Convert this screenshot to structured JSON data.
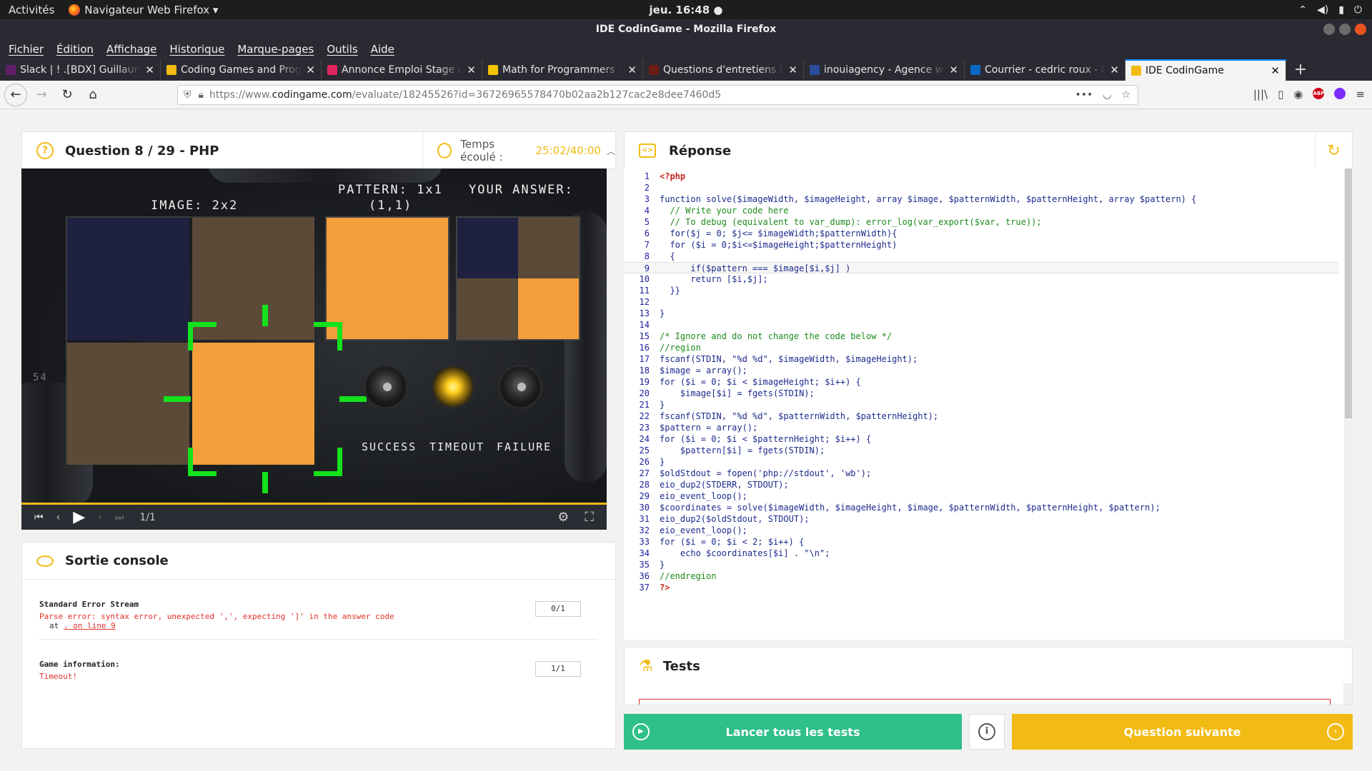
{
  "gnome": {
    "activities": "Activités",
    "app": "Navigateur Web Firefox ▾",
    "clock": "jeu. 16:48 ●",
    "tray": [
      "▾",
      "🔊",
      "🔋",
      "⏻"
    ]
  },
  "window": {
    "title": "IDE CodinGame - Mozilla Firefox"
  },
  "menu": [
    "Fichier",
    "Édition",
    "Affichage",
    "Historique",
    "Marque-pages",
    "Outils",
    "Aide"
  ],
  "tabs": [
    {
      "label": "Slack | ! .[BDX] Guillaume",
      "color": "#611f69"
    },
    {
      "label": "Coding Games and Progr",
      "color": "#f2bb13"
    },
    {
      "label": "Annonce Emploi Stage d",
      "color": "#e0245e"
    },
    {
      "label": "Math for Programmers -",
      "color": "#f5c400"
    },
    {
      "label": "Questions d'entretiens P",
      "color": "#6b1d12"
    },
    {
      "label": "inouiagency - Agence we",
      "color": "#2a4d9c"
    },
    {
      "label": "Courrier - cedric roux - O",
      "color": "#0a68c4"
    },
    {
      "label": "IDE CodinGame",
      "color": "#f2bb13"
    }
  ],
  "url": {
    "prefix": "https://www.",
    "domain": "codingame.com",
    "rest": "/evaluate/18245526?id=36726965578470b02aa2b127cac2e8dee7460d5"
  },
  "question": {
    "title": "Question 8 / 29 - PHP",
    "time_label": "Temps écoulé :",
    "time_value": "25:02/40:00"
  },
  "game": {
    "image_label": "IMAGE: 2x2",
    "pattern_label": "PATTERN: 1x1",
    "pattern_coords": "(1,1)",
    "answer_label": "YOUR ANSWER:",
    "status_success": "SUCCESS",
    "status_timeout": "TIMEOUT",
    "status_failure": "FAILURE",
    "frame": "1/1",
    "side_num": "54",
    "colors": {
      "navy": "#1e2140",
      "brown": "#5c4a39",
      "orange": "#f39f3c",
      "green": "#14e21c"
    }
  },
  "console": {
    "title": "Sortie console",
    "stderr_title": "Standard Error Stream",
    "stderr_msg": "Parse error: syntax error, unexpected ',', expecting ']' in the answer code",
    "stderr_at": "at",
    "stderr_link": ". on line 9",
    "stderr_count": "0/1",
    "game_title": "Game information:",
    "game_msg": "Timeout!",
    "game_count": "1/1"
  },
  "response": {
    "title": "Réponse"
  },
  "tests": {
    "title": "Tests"
  },
  "buttons": {
    "run_all": "Lancer tous les tests",
    "info": "i",
    "next": "Question suivante"
  },
  "accent": {
    "yellow": "#f2bb13",
    "green": "#2fbf8a"
  },
  "code": [
    {
      "n": "1",
      "t": "<?php",
      "k": "php"
    },
    {
      "n": "2",
      "t": "",
      "k": ""
    },
    {
      "n": "3",
      "t": "function solve($imageWidth, $imageHeight, array $image, $patternWidth, $patternHeight, array $pattern) {",
      "k": "cl"
    },
    {
      "n": "4",
      "t": "  // Write your code here",
      "k": "cm"
    },
    {
      "n": "5",
      "t": "  // To debug (equivalent to var_dump): error_log(var_export($var, true));",
      "k": "cm"
    },
    {
      "n": "6",
      "t": "  for($j = 0; $j<= $imageWidth;$patternWidth){",
      "k": "cl"
    },
    {
      "n": "7",
      "t": "  for ($i = 0;$i<=$imageHeight;$patternHeight)",
      "k": "cl"
    },
    {
      "n": "8",
      "t": "  {",
      "k": "cl"
    },
    {
      "n": "9",
      "t": "      if($pattern === $image[$i,$j] )",
      "k": "cl"
    },
    {
      "n": "10",
      "t": "      return [$i,$j];",
      "k": "cl"
    },
    {
      "n": "11",
      "t": "  }}",
      "k": "cl"
    },
    {
      "n": "12",
      "t": "",
      "k": ""
    },
    {
      "n": "13",
      "t": "}",
      "k": "cl"
    },
    {
      "n": "14",
      "t": "",
      "k": ""
    },
    {
      "n": "15",
      "t": "/* Ignore and do not change the code below */",
      "k": "cm"
    },
    {
      "n": "16",
      "t": "//region",
      "k": "cm"
    },
    {
      "n": "17",
      "t": "fscanf(STDIN, \"%d %d\", $imageWidth, $imageHeight);",
      "k": "cl"
    },
    {
      "n": "18",
      "t": "$image = array();",
      "k": "cl"
    },
    {
      "n": "19",
      "t": "for ($i = 0; $i < $imageHeight; $i++) {",
      "k": "cl"
    },
    {
      "n": "20",
      "t": "    $image[$i] = fgets(STDIN);",
      "k": "cl"
    },
    {
      "n": "21",
      "t": "}",
      "k": "cl"
    },
    {
      "n": "22",
      "t": "fscanf(STDIN, \"%d %d\", $patternWidth, $patternHeight);",
      "k": "cl"
    },
    {
      "n": "23",
      "t": "$pattern = array();",
      "k": "cl"
    },
    {
      "n": "24",
      "t": "for ($i = 0; $i < $patternHeight; $i++) {",
      "k": "cl"
    },
    {
      "n": "25",
      "t": "    $pattern[$i] = fgets(STDIN);",
      "k": "cl"
    },
    {
      "n": "26",
      "t": "}",
      "k": "cl"
    },
    {
      "n": "27",
      "t": "$oldStdout = fopen('php://stdout', 'wb');",
      "k": "cl"
    },
    {
      "n": "28",
      "t": "eio_dup2(STDERR, STDOUT);",
      "k": "cl"
    },
    {
      "n": "29",
      "t": "eio_event_loop();",
      "k": "cl"
    },
    {
      "n": "30",
      "t": "$coordinates = solve($imageWidth, $imageHeight, $image, $patternWidth, $patternHeight, $pattern);",
      "k": "cl"
    },
    {
      "n": "31",
      "t": "eio_dup2($oldStdout, STDOUT);",
      "k": "cl"
    },
    {
      "n": "32",
      "t": "eio_event_loop();",
      "k": "cl"
    },
    {
      "n": "33",
      "t": "for ($i = 0; $i < 2; $i++) {",
      "k": "cl"
    },
    {
      "n": "34",
      "t": "    echo $coordinates[$i] . \"\\n\";",
      "k": "cl"
    },
    {
      "n": "35",
      "t": "}",
      "k": "cl"
    },
    {
      "n": "36",
      "t": "//endregion",
      "k": "cm"
    },
    {
      "n": "37",
      "t": "?>",
      "k": "php"
    }
  ]
}
